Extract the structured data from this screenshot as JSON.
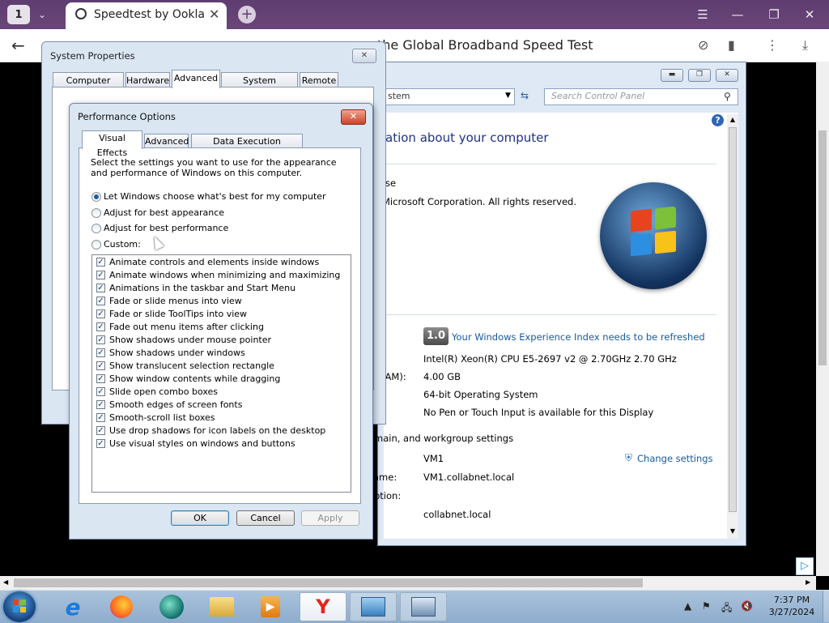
{
  "browser": {
    "tab_count": "1",
    "tab_title": "Speedtest by Ookla - Th",
    "page_title": "the Global Broadband Speed Test"
  },
  "control_panel": {
    "address": "stem",
    "search_placeholder": "Search Control Panel",
    "heading": "ation about your computer",
    "line_se": "se",
    "copyright": "Microsoft Corporation.  All rights reserved.",
    "wei_score": "1.0",
    "wei_link": "Your Windows Experience Index needs to be refreshed",
    "processor": "Intel(R) Xeon(R) CPU E5-2697 v2 @ 2.70GHz   2.70 GHz",
    "ram_label": "RAM):",
    "ram": "4.00 GB",
    "system_type": "64-bit Operating System",
    "pen_touch": "No Pen or Touch Input is available for this Display",
    "domain_section": "main, and workgroup settings",
    "computer_name": "VM1",
    "change_settings": "Change settings",
    "full_name_label": "ame:",
    "full_name": "VM1.collabnet.local",
    "description_label": "ption:",
    "domain": "collabnet.local"
  },
  "system_properties": {
    "title": "System Properties",
    "close": "✕",
    "tabs": [
      "Computer Name",
      "Hardware",
      "Advanced",
      "System Protection",
      "Remote"
    ]
  },
  "performance_options": {
    "title": "Performance Options",
    "close": "✕",
    "tabs": [
      "Visual Effects",
      "Advanced",
      "Data Execution Prevention"
    ],
    "description": "Select the settings you want to use for the appearance and performance of Windows on this computer.",
    "options": [
      "Let Windows choose what's best for my computer",
      "Adjust for best appearance",
      "Adjust for best performance",
      "Custom:"
    ],
    "effects": [
      "Animate controls and elements inside windows",
      "Animate windows when minimizing and maximizing",
      "Animations in the taskbar and Start Menu",
      "Fade or slide menus into view",
      "Fade or slide ToolTips into view",
      "Fade out menu items after clicking",
      "Show shadows under mouse pointer",
      "Show shadows under windows",
      "Show translucent selection rectangle",
      "Show window contents while dragging",
      "Slide open combo boxes",
      "Smooth edges of screen fonts",
      "Smooth-scroll list boxes",
      "Use drop shadows for icon labels on the desktop",
      "Use visual styles on windows and buttons"
    ],
    "ok": "OK",
    "cancel": "Cancel",
    "apply": "Apply"
  },
  "taskbar": {
    "time": "7:37 PM",
    "date": "3/27/2024"
  },
  "icons": [
    "chevron-down-icon",
    "close-icon",
    "plus-icon",
    "menu-icon",
    "minimize-icon",
    "restore-icon",
    "back-arrow-icon",
    "shield-icon",
    "bookmark-icon",
    "more-icon",
    "download-icon",
    "search-icon",
    "help-icon",
    "refresh-icon",
    "windows-logo-icon",
    "start-orb-icon",
    "ie-icon",
    "firefox-icon",
    "yandex-icon",
    "folder-icon",
    "media-icon",
    "flag-icon",
    "network-icon",
    "volume-mute-icon"
  ]
}
